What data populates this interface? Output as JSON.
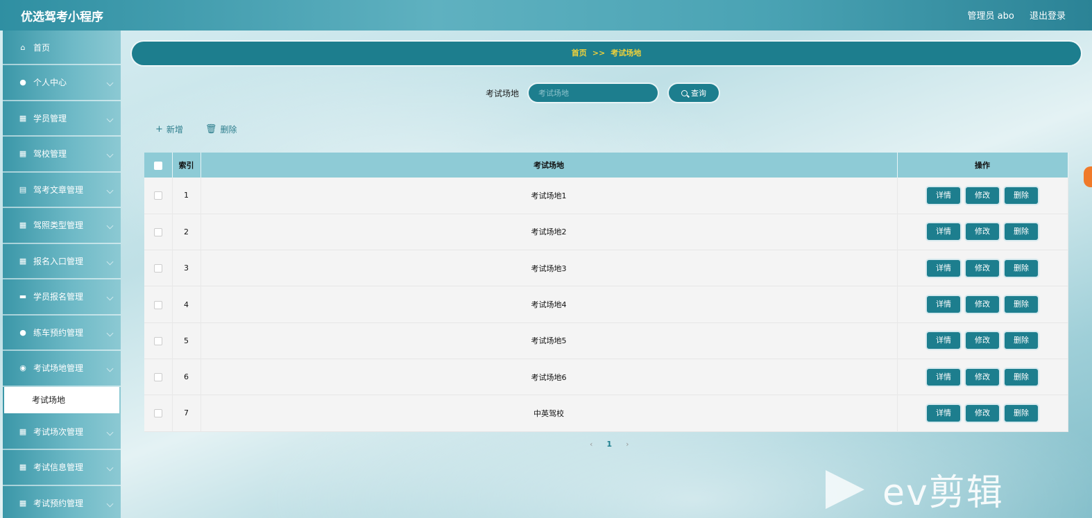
{
  "app": {
    "title": "优选驾考小程序"
  },
  "topbar": {
    "user": "管理员 abo",
    "logout": "退出登录"
  },
  "sidebar": {
    "items": [
      {
        "label": "首页",
        "icon": "home-icon",
        "glyph": "⌂",
        "has_chevron": false
      },
      {
        "label": "个人中心",
        "icon": "user-icon",
        "glyph": "●",
        "has_chevron": true
      },
      {
        "label": "学员管理",
        "icon": "grid-icon",
        "glyph": "▦",
        "has_chevron": true
      },
      {
        "label": "驾校管理",
        "icon": "grid-icon",
        "glyph": "▦",
        "has_chevron": true
      },
      {
        "label": "驾考文章管理",
        "icon": "clipboard-icon",
        "glyph": "▤",
        "has_chevron": true
      },
      {
        "label": "驾照类型管理",
        "icon": "grid-icon",
        "glyph": "▦",
        "has_chevron": true
      },
      {
        "label": "报名入口管理",
        "icon": "grid-icon",
        "glyph": "▦",
        "has_chevron": true
      },
      {
        "label": "学员报名管理",
        "icon": "briefcase-icon",
        "glyph": "▬",
        "has_chevron": true
      },
      {
        "label": "练车预约管理",
        "icon": "user-icon",
        "glyph": "●",
        "has_chevron": true
      },
      {
        "label": "考试场地管理",
        "icon": "location-icon",
        "glyph": "◉",
        "has_chevron": true
      }
    ],
    "active_sub": "考试场地",
    "items_after": [
      {
        "label": "考试场次管理",
        "icon": "grid-icon",
        "glyph": "▦",
        "has_chevron": true
      },
      {
        "label": "考试信息管理",
        "icon": "grid-icon",
        "glyph": "▦",
        "has_chevron": true
      },
      {
        "label": "考试预约管理",
        "icon": "grid-icon",
        "glyph": "▦",
        "has_chevron": true
      }
    ]
  },
  "breadcrumb": {
    "home": "首页",
    "sep": ">>",
    "current": "考试场地"
  },
  "search": {
    "label": "考试场地",
    "placeholder": "考试场地",
    "button": "查询"
  },
  "actions": {
    "add": "新增",
    "delete": "删除"
  },
  "table": {
    "columns": [
      "索引",
      "考试场地",
      "操作"
    ],
    "rows": [
      {
        "index": "1",
        "name": "考试场地1"
      },
      {
        "index": "2",
        "name": "考试场地2"
      },
      {
        "index": "3",
        "name": "考试场地3"
      },
      {
        "index": "4",
        "name": "考试场地4"
      },
      {
        "index": "5",
        "name": "考试场地5"
      },
      {
        "index": "6",
        "name": "考试场地6"
      },
      {
        "index": "7",
        "name": "中英驾校"
      }
    ],
    "row_buttons": {
      "detail": "详情",
      "edit": "修改",
      "delete": "删除"
    }
  },
  "pagination": {
    "prev": "‹",
    "current": "1",
    "next": "›"
  },
  "watermark": {
    "text": "ev剪辑"
  },
  "colors": {
    "primary": "#1d7e8e",
    "header": "#8ecbd6",
    "breadcrumb_text": "#f0d23a"
  }
}
